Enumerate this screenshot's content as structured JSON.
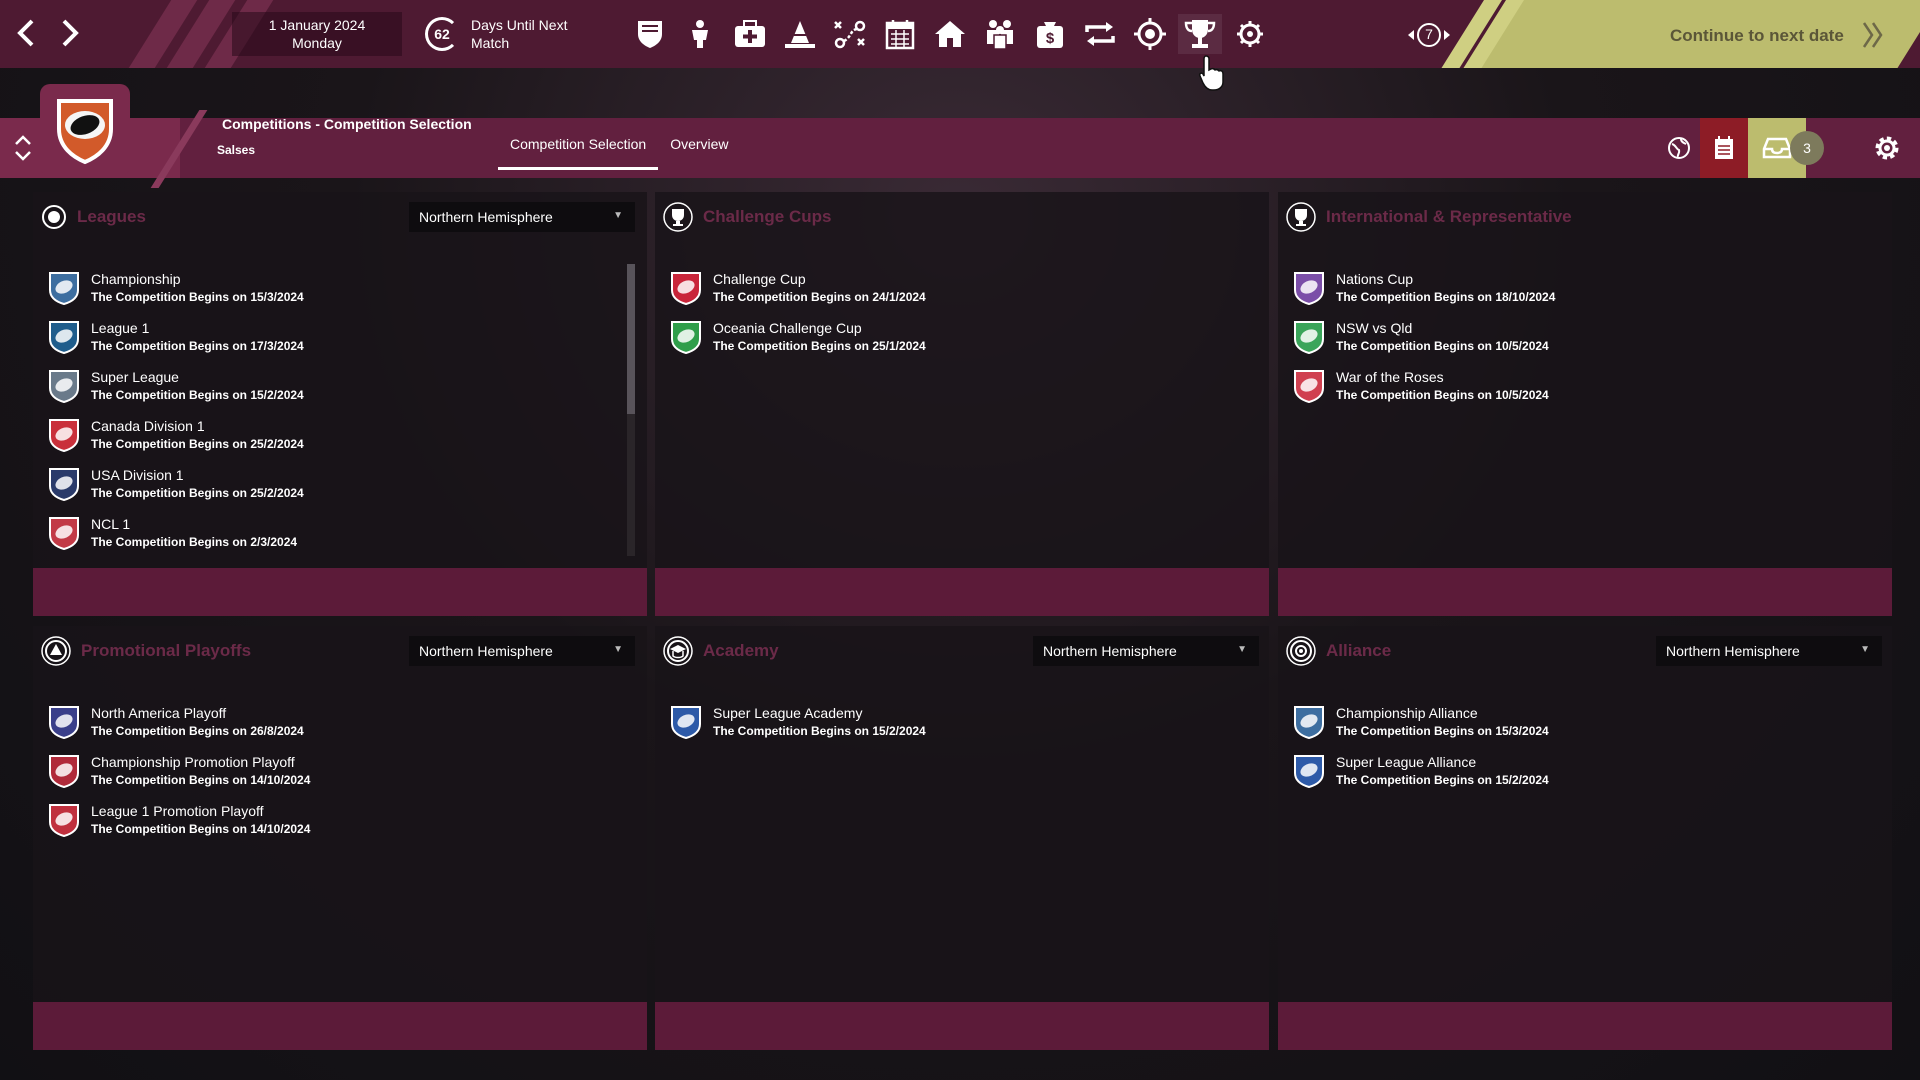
{
  "topbar": {
    "date": "1 January 2024",
    "weekday": "Monday",
    "days_count": "62",
    "days_label": "Days Until Next Match",
    "icons": [
      "club-shield-icon",
      "team-icon",
      "medical-icon",
      "training-cone-icon",
      "tactics-icon",
      "calendar-icon",
      "home-icon",
      "staff-icon",
      "finance-icon",
      "transfers-icon",
      "scouting-icon",
      "trophy-icon",
      "settings-people-icon"
    ],
    "back_count": "7",
    "continue_label": "Continue to next date"
  },
  "subheader": {
    "breadcrumb": "Competitions - Competition Selection",
    "club": "Salses",
    "tabs": [
      "Competition Selection",
      "Overview"
    ],
    "inbox_count": "3"
  },
  "panels": {
    "leagues": {
      "title": "Leagues",
      "filter": "Northern Hemisphere",
      "items": [
        {
          "name": "Championship",
          "date": "The Competition Begins on 15/3/2024",
          "color": "#3d6ea0"
        },
        {
          "name": "League 1",
          "date": "The Competition Begins on 17/3/2024",
          "color": "#1f5d8c"
        },
        {
          "name": "Super League",
          "date": "The Competition Begins on 15/2/2024",
          "color": "#6a7a8a"
        },
        {
          "name": "Canada Division 1",
          "date": "The Competition Begins on 25/2/2024",
          "color": "#c9303b"
        },
        {
          "name": "USA Division 1",
          "date": "The Competition Begins on 25/2/2024",
          "color": "#2a3a6a"
        },
        {
          "name": "NCL 1",
          "date": "The Competition Begins on 2/3/2024",
          "color": "#c23a46"
        }
      ]
    },
    "challenge_cups": {
      "title": "Challenge Cups",
      "items": [
        {
          "name": "Challenge Cup",
          "date": "The Competition Begins on 24/1/2024",
          "color": "#c9253a"
        },
        {
          "name": "Oceania Challenge Cup",
          "date": "The Competition Begins on 25/1/2024",
          "color": "#2f9e4a"
        }
      ]
    },
    "international": {
      "title": "International & Representative",
      "items": [
        {
          "name": "Nations Cup",
          "date": "The Competition Begins on 18/10/2024",
          "color": "#7b4ea8"
        },
        {
          "name": "NSW vs Qld",
          "date": "The Competition Begins on 10/5/2024",
          "color": "#3aa55a"
        },
        {
          "name": "War of the Roses",
          "date": "The Competition Begins on 10/5/2024",
          "color": "#d04050"
        }
      ]
    },
    "playoffs": {
      "title": "Promotional Playoffs",
      "filter": "Northern Hemisphere",
      "items": [
        {
          "name": "North America Playoff",
          "date": "The Competition Begins on 26/8/2024",
          "color": "#3a3f8a"
        },
        {
          "name": "Championship Promotion Playoff",
          "date": "The Competition Begins on 14/10/2024",
          "color": "#b02a3a"
        },
        {
          "name": "League 1 Promotion Playoff",
          "date": "The Competition Begins on 14/10/2024",
          "color": "#c0303e"
        }
      ]
    },
    "academy": {
      "title": "Academy",
      "filter": "Northern Hemisphere",
      "items": [
        {
          "name": "Super League Academy",
          "date": "The Competition Begins on 15/2/2024",
          "color": "#2d5aa8"
        }
      ]
    },
    "alliance": {
      "title": "Alliance",
      "filter": "Northern Hemisphere",
      "items": [
        {
          "name": "Championship Alliance",
          "date": "The Competition Begins on 15/3/2024",
          "color": "#3d6ea0"
        },
        {
          "name": "Super League Alliance",
          "date": "The Competition Begins on 15/2/2024",
          "color": "#2d5aa8"
        }
      ]
    }
  },
  "colors": {
    "topbar": "#4e1a32",
    "subheader": "#62203f",
    "accent_yellow": "#bcbc6e",
    "panel_footer": "#5c1b39",
    "panel_title": "#6b2a48"
  }
}
